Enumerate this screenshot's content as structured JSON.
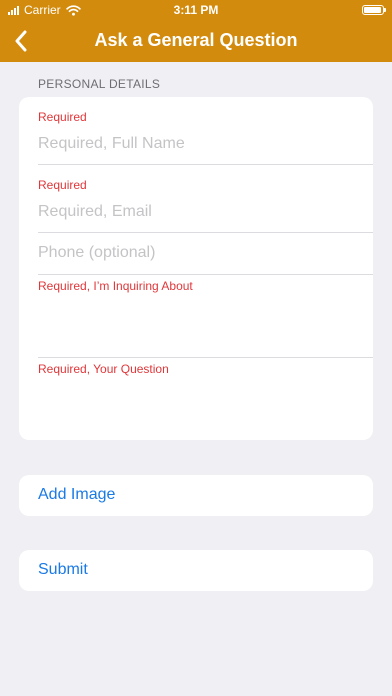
{
  "status_bar": {
    "carrier": "Carrier",
    "time": "3:11 PM"
  },
  "nav": {
    "title": "Ask a General Question",
    "back_icon": "chevron-left-icon"
  },
  "colors": {
    "header": "#d38b0d",
    "required": "#e0373a",
    "action": "#1a7ae5",
    "background": "#efeff4"
  },
  "personal_details": {
    "header": "PERSONAL DETAILS",
    "full_name": {
      "error": "Required",
      "placeholder": "Required, Full Name",
      "value": ""
    },
    "email": {
      "error": "Required",
      "placeholder": "Required, Email",
      "value": ""
    },
    "phone": {
      "placeholder": "Phone (optional)",
      "value": ""
    },
    "inquiring_about": {
      "label": "Required, I’m Inquiring About",
      "value": ""
    },
    "question": {
      "label": "Required, Your Question",
      "value": ""
    }
  },
  "actions": {
    "add_image": "Add Image",
    "submit": "Submit"
  }
}
